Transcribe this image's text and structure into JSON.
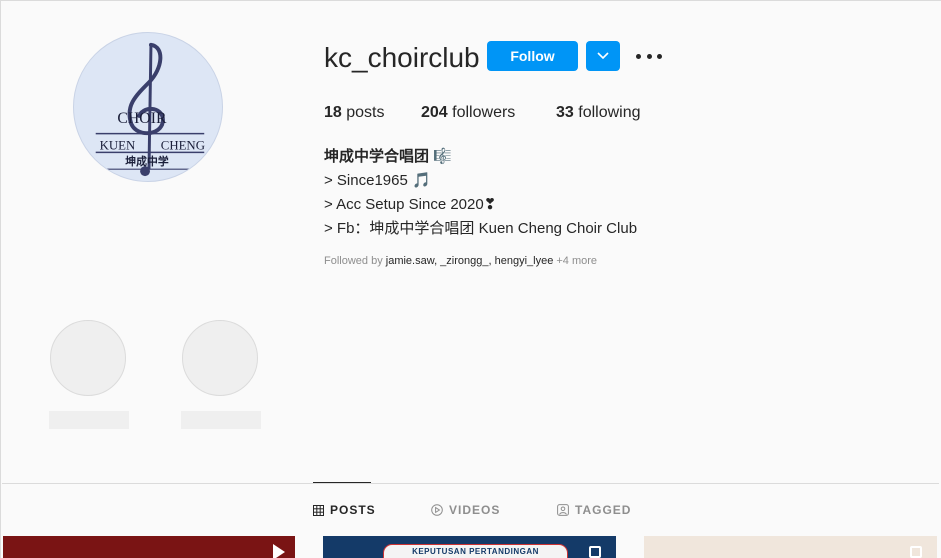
{
  "profile": {
    "username": "kc_choirclub",
    "follow_label": "Follow",
    "avatar_text": {
      "choir": "CHOIR",
      "kuen": "KUEN",
      "cheng": "CHENG",
      "chinese": "坤成中学"
    }
  },
  "stats": {
    "posts_count": "18",
    "posts_label": "posts",
    "followers_count": "204",
    "followers_label": "followers",
    "following_count": "33",
    "following_label": "following"
  },
  "bio": {
    "name": "坤成中学合唱团 🎼",
    "lines": [
      "> Since1965 🎵",
      "> Acc Setup Since 2020❣",
      "> Fb：坤成中学合唱团 Kuen Cheng Choir Club"
    ]
  },
  "followed_by": {
    "prefix": "Followed by ",
    "names": "jamie.saw, _zirongg_, hengyi_lyee",
    "more": " +4 more"
  },
  "tabs": [
    {
      "label": "POSTS",
      "icon": "grid-icon",
      "active": true
    },
    {
      "label": "VIDEOS",
      "icon": "play-icon",
      "active": false
    },
    {
      "label": "TAGGED",
      "icon": "tag-icon",
      "active": false
    }
  ],
  "posts": {
    "post2_banner": "KEPUTUSAN PERTANDINGAN"
  },
  "colors": {
    "accent": "#0095f6",
    "text": "#262626",
    "muted": "#8e8e8e",
    "background": "#fafafa"
  }
}
